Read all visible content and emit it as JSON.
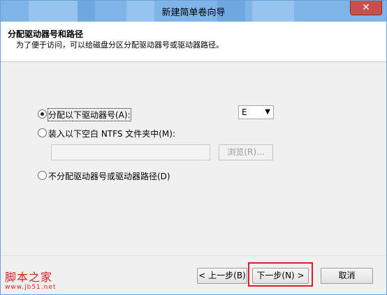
{
  "window": {
    "title": "新建简单卷向导"
  },
  "header": {
    "title": "分配驱动器号和路径",
    "subtitle": "为了便于访问，可以给磁盘分区分配驱动器号或驱动器路径。"
  },
  "options": {
    "assign_letter_label": "分配以下驱动器号(A):",
    "drive_letter_value": "E",
    "mount_folder_label": "装入以下空白 NTFS 文件夹中(M):",
    "folder_path_value": "",
    "browse_label": "浏览(R)...",
    "no_assign_label": "不分配驱动器号或驱动器路径(D)",
    "selected": "assign_letter"
  },
  "footer": {
    "back_label": "< 上一步(B)",
    "next_label": "下一步(N) >",
    "cancel_label": "取消"
  },
  "watermark": {
    "logo_text": "脚本之家",
    "url_text": "www.jb51.net"
  },
  "colors": {
    "title_bar": "#7fb4e8",
    "close_button": "#c7504a",
    "highlight_border": "#d81f26"
  }
}
